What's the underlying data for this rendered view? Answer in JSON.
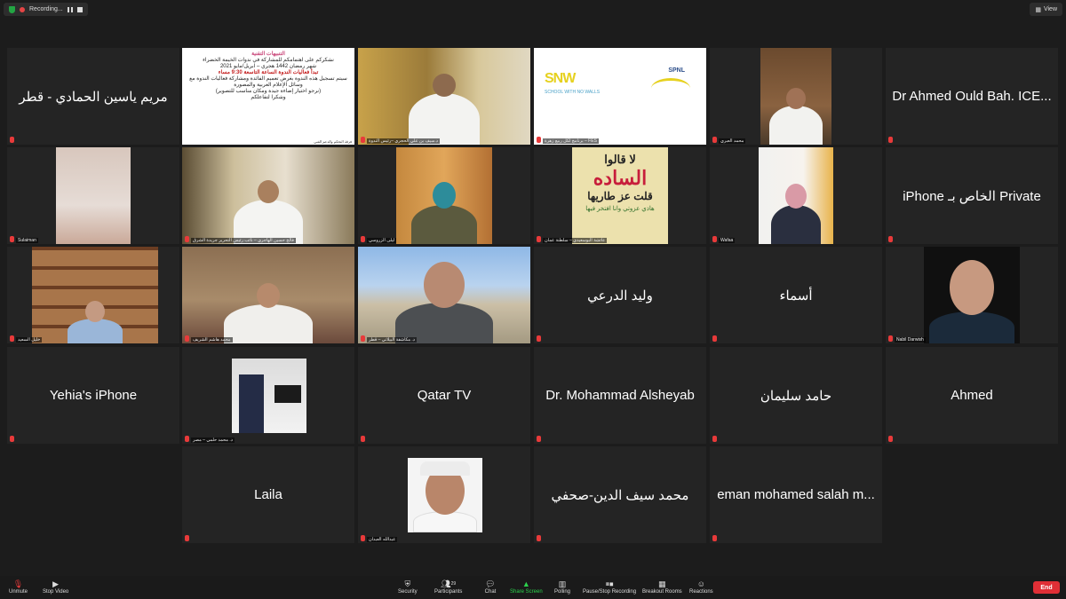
{
  "topbar": {
    "recording_label": "Recording...",
    "view_label": "View"
  },
  "tiles": {
    "t0": "مريم ياسين الحمادي - قطر",
    "t1_label": "فرقة التحكم والدعم الفني",
    "t1_slide": {
      "title": "التنبيهات التقنية",
      "line1": "نشكركم على اهتمامكم للمشاركة في ندوات الخيمة الخضراء",
      "line2": "شهر رمضان 1442 هجري – ابريل/مايو 2021",
      "line3": "تبدأ فعاليات الندوة الساعة التاسعة 9:30 مساء",
      "line4": "سيتم تسجيل هذه الندوة بغرض تعميم الفائدة ومشاركة فعاليات الندوة مع وسائل الإعلام العربية والمصورة",
      "line5": "(نرجو اختيار إضاءة جيدة ومكان مناسب للتصوير)",
      "line6": "وشكرا لتفاعلكم"
    },
    "t2_label": "د.سيف بن علي الحجري –رئيس الندوة",
    "t3_label": "برنامج لكل ربيع زهرة – FES",
    "t3_logo1": "SNW",
    "t3_logo1_sub": "SCHOOL WITH NO WALLS",
    "t3_logo2": "SPNL",
    "t4_label": "محمد العبري",
    "t5": "Dr Ahmed Ould Bah. ICE...",
    "t6_label": "Sulaiman",
    "t7_label": "فالح حسين الهاجري – نائب رئيس التحرير جريدة الشرق",
    "t8_label": "ليلى الزروسي",
    "t9_label": "عائشة البوسعيدي – سلطنة عمان",
    "t9_sign": {
      "l1": "لا قالوا",
      "l2": "الساده",
      "l3": "قلت عز طاريها",
      "l4": "هاذي عزوتي وانا افتخر فيها"
    },
    "t10_label": "Wafaa",
    "t11": "iPhone الخاص بـ Private",
    "t12_label": "خليل السعيد",
    "t13_label": "محمد هاشم الشريف",
    "t14_label": "د. مكاشفة البيلاتي – قطر",
    "t15": "وليد الدرعي",
    "t16": "أسماء",
    "t17_label": "Nabil Darwish",
    "t18": "Yehia's iPhone",
    "t19_label": "د. محمد حلمي – مصر",
    "t20": "Qatar TV",
    "t21": "Dr. Mohammad Alsheyab",
    "t22": "حامد سليمان",
    "t23": "Ahmed",
    "t24": "Laila",
    "t25_label": "عبدالله العبدان",
    "t26": "محمد سيف الدين-صحفي",
    "t27": "eman mohamed salah m..."
  },
  "toolbar": {
    "unmute": "Unmute",
    "stop_video": "Stop Video",
    "security": "Security",
    "participants": "Participants",
    "participants_count": "29",
    "chat": "Chat",
    "share_screen": "Share Screen",
    "polling": "Polling",
    "pause_recording": "Pause/Stop Recording",
    "breakout": "Breakout Rooms",
    "reactions": "Reactions",
    "end": "End"
  },
  "colors": {
    "active_speaker": "#7ed321",
    "end_button": "#e02f36",
    "share_screen": "#2bd34c",
    "muted_mic": "#e83a3a"
  }
}
